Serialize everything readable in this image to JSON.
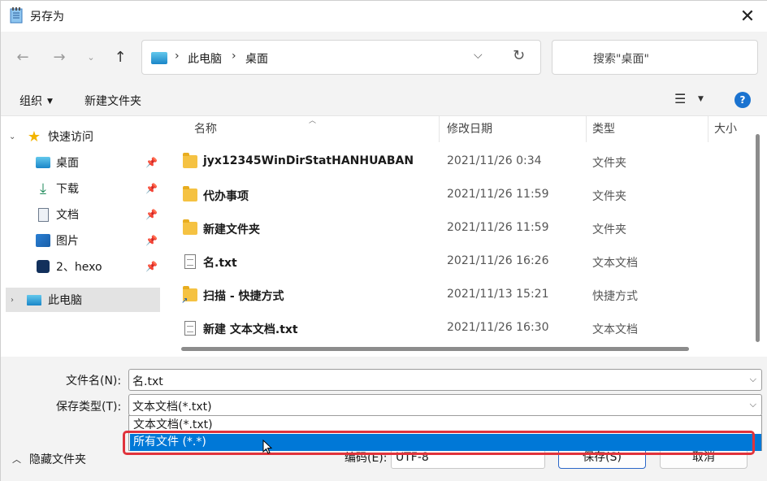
{
  "window": {
    "title": "另存为"
  },
  "nav": {
    "address": [
      "此电脑",
      "桌面"
    ],
    "search_placeholder": "搜索\"桌面\""
  },
  "commands": {
    "organize": "组织",
    "new_folder": "新建文件夹"
  },
  "sidebar": {
    "quick_access": "快速访问",
    "items": [
      {
        "label": "桌面"
      },
      {
        "label": "下载"
      },
      {
        "label": "文档"
      },
      {
        "label": "图片"
      },
      {
        "label": "2、hexo"
      }
    ],
    "this_pc": "此电脑"
  },
  "columns": {
    "name": "名称",
    "date": "修改日期",
    "type": "类型",
    "size": "大小"
  },
  "files": [
    {
      "name": "jyx12345WinDirStatHANHUABAN",
      "date": "2021/11/26 0:34",
      "type": "文件夹",
      "icon": "folder-icon"
    },
    {
      "name": "代办事项",
      "date": "2021/11/26 11:59",
      "type": "文件夹",
      "icon": "folder-icon"
    },
    {
      "name": "新建文件夹",
      "date": "2021/11/26 11:59",
      "type": "文件夹",
      "icon": "folder-icon"
    },
    {
      "name": "名.txt",
      "date": "2021/11/26 16:26",
      "type": "文本文档",
      "icon": "text-file-icon"
    },
    {
      "name": "扫描 - 快捷方式",
      "date": "2021/11/13 15:21",
      "type": "快捷方式",
      "icon": "shortcut-icon"
    },
    {
      "name": "新建 文本文档.txt",
      "date": "2021/11/26 16:30",
      "type": "文本文档",
      "icon": "text-file-icon"
    }
  ],
  "form": {
    "filename_label": "文件名(N):",
    "filename_value": "名.txt",
    "savetype_label": "保存类型(T):",
    "savetype_value": "文本文档(*.txt)",
    "savetype_options": [
      "文本文档(*.txt)",
      "所有文件 (*.*)"
    ],
    "hide_folders": "隐藏文件夹",
    "encoding_label": "编码(E):",
    "encoding_value": "UTF-8",
    "save_button": "保存(S)",
    "cancel_button": "取消"
  },
  "colors": {
    "accent": "#0078d7",
    "highlight_border": "#e0333c"
  }
}
